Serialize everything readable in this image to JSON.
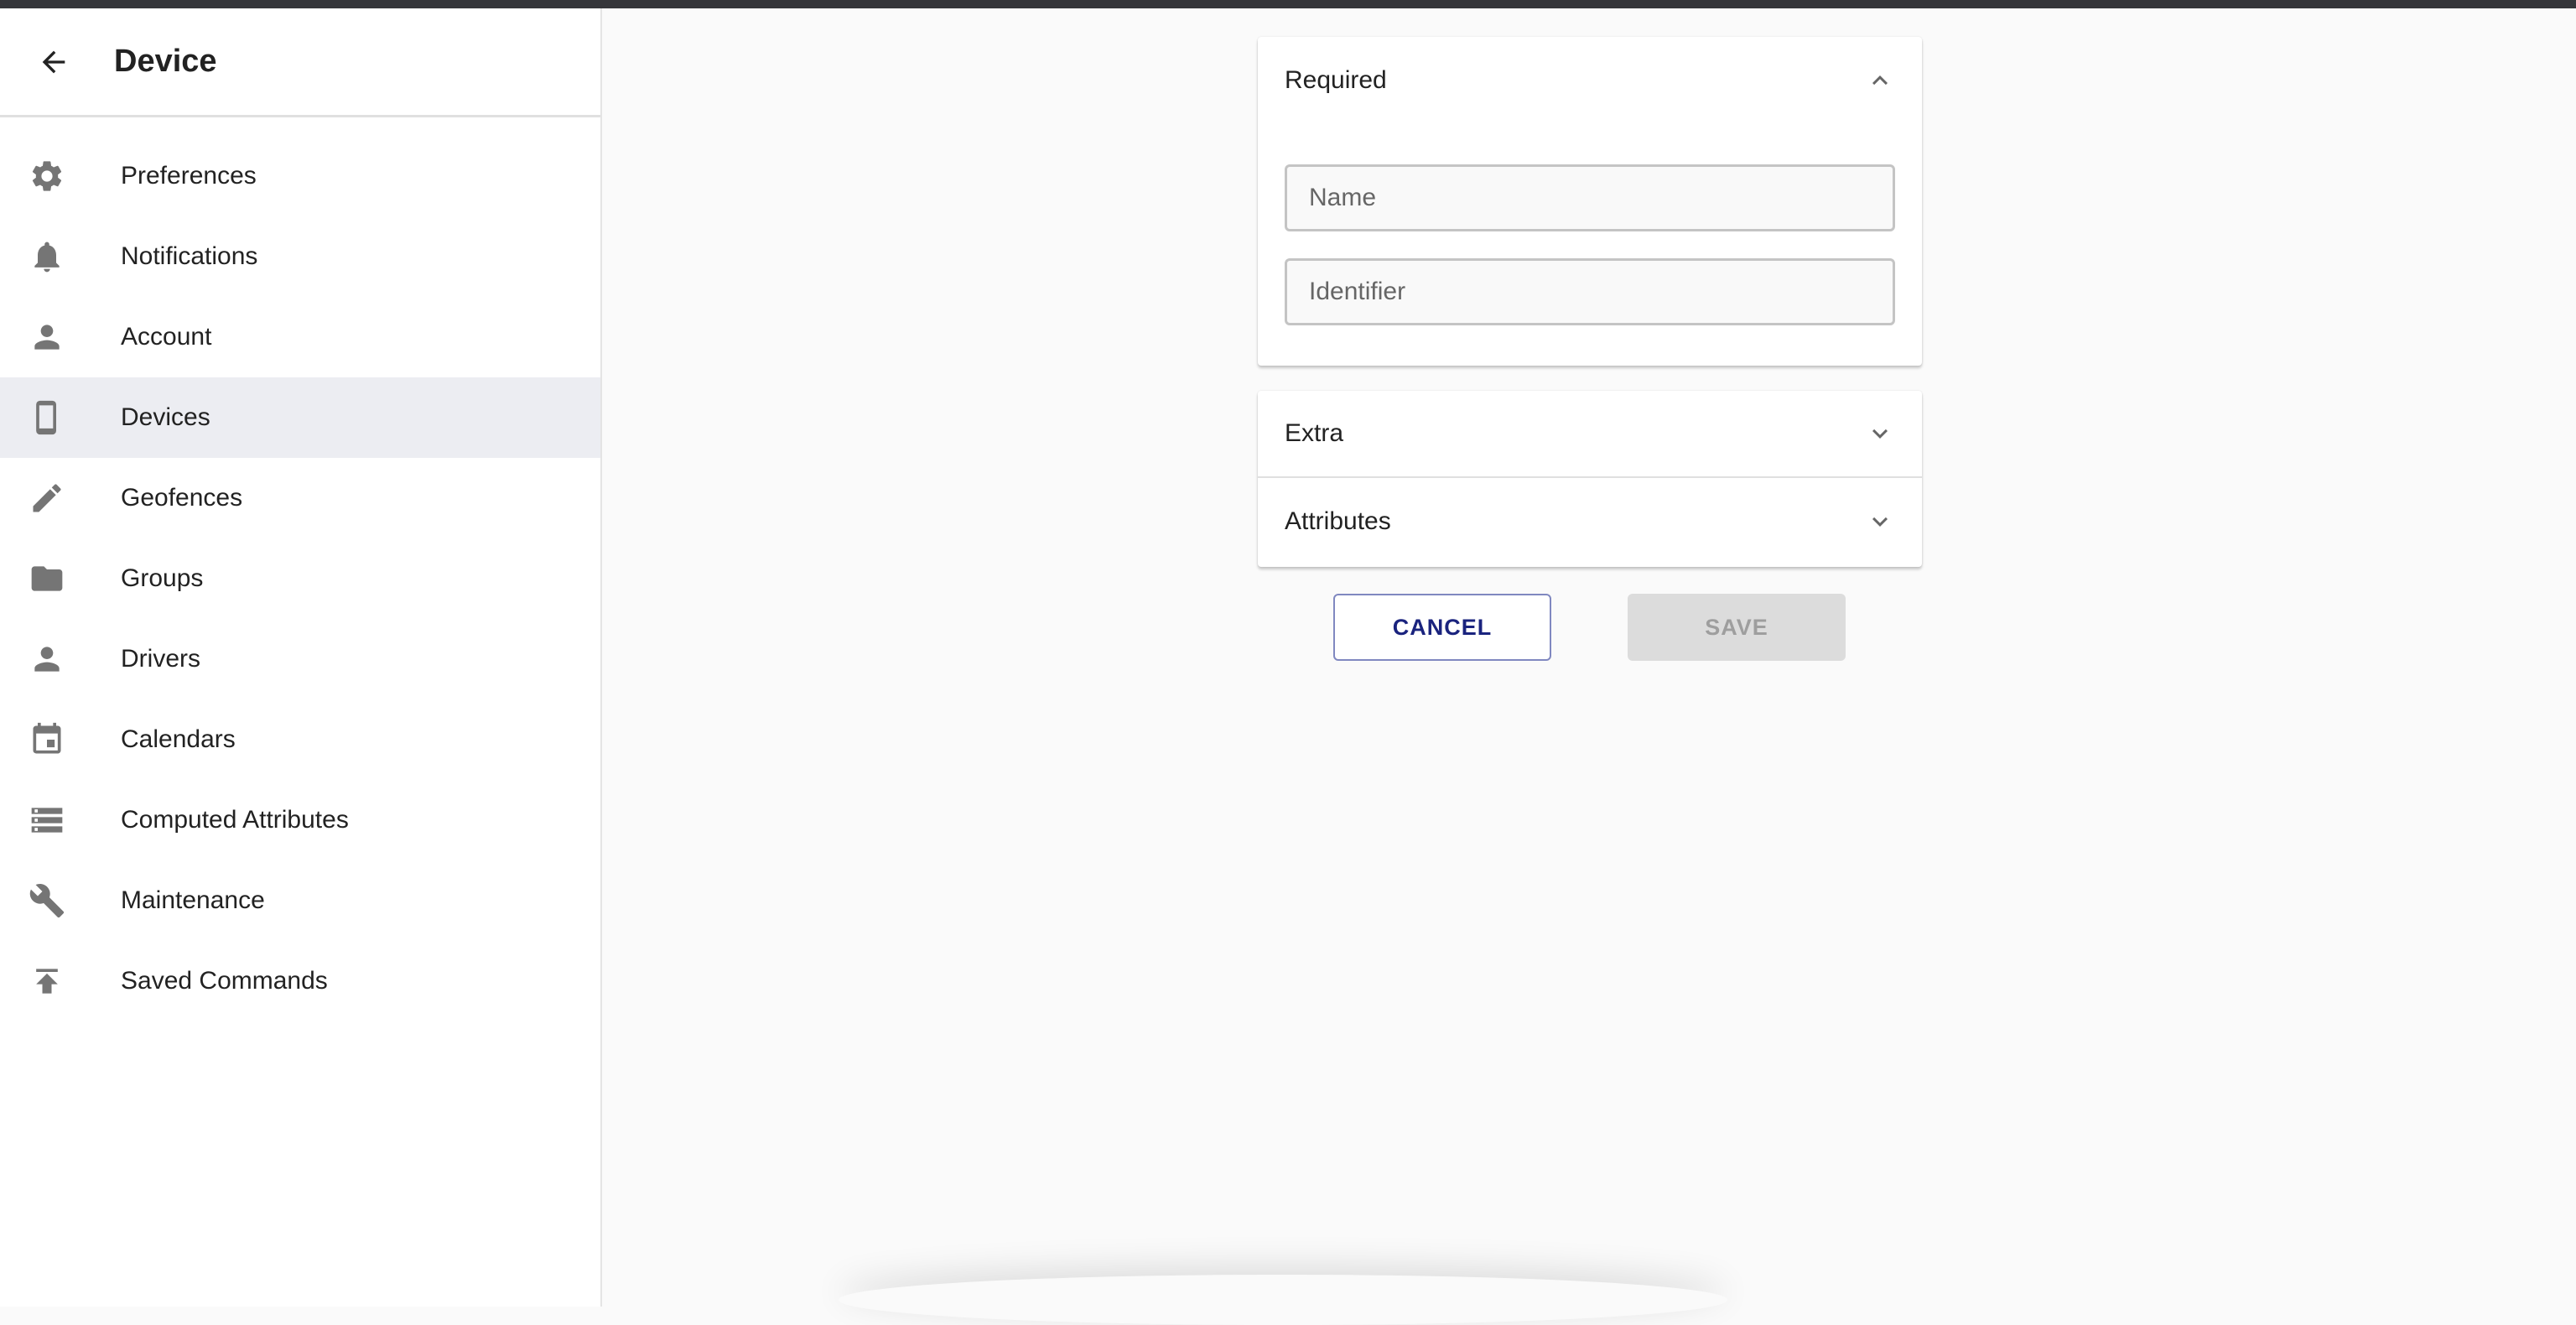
{
  "sidebar": {
    "title": "Device",
    "items": [
      {
        "label": "Preferences",
        "icon": "gear-icon"
      },
      {
        "label": "Notifications",
        "icon": "bell-icon"
      },
      {
        "label": "Account",
        "icon": "person-icon"
      },
      {
        "label": "Devices",
        "icon": "phone-icon",
        "selected": true
      },
      {
        "label": "Geofences",
        "icon": "pencil-icon"
      },
      {
        "label": "Groups",
        "icon": "folder-icon"
      },
      {
        "label": "Drivers",
        "icon": "person-icon"
      },
      {
        "label": "Calendars",
        "icon": "calendar-icon"
      },
      {
        "label": "Computed Attributes",
        "icon": "storage-icon"
      },
      {
        "label": "Maintenance",
        "icon": "wrench-icon"
      },
      {
        "label": "Saved Commands",
        "icon": "publish-icon"
      }
    ]
  },
  "form": {
    "required": {
      "title": "Required",
      "name_placeholder": "Name",
      "identifier_placeholder": "Identifier"
    },
    "extra": {
      "title": "Extra"
    },
    "attributes": {
      "title": "Attributes"
    },
    "cancel_label": "CANCEL",
    "save_label": "SAVE"
  },
  "colors": {
    "accent": "#1a237e",
    "selected_bg": "#ecedf2",
    "icon": "#757575"
  }
}
